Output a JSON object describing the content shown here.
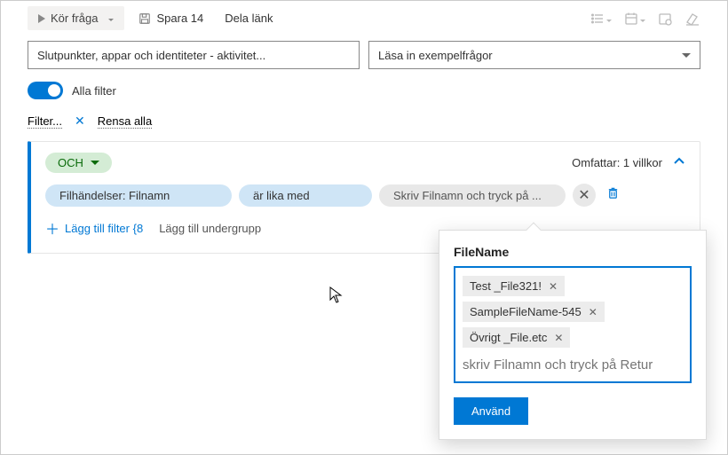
{
  "toolbar": {
    "run": "Kör fråga",
    "save": "Spara 14",
    "share": "Dela länk"
  },
  "inputs": {
    "endpoints": "Slutpunkter, appar och identiteter - aktivitet...",
    "examples": "Läsa in exempelfrågor"
  },
  "toggle": {
    "label": "Alla filter"
  },
  "filterLinks": {
    "filter": "Filter...",
    "clear": "Rensa alla"
  },
  "card": {
    "and": "OCH",
    "scope": "Omfattar: 1 villkor",
    "field": "Filhändelser: Filnamn",
    "op": "är lika med",
    "valuePlaceholder": "Skriv Filnamn och tryck på ...",
    "addFilter": "Lägg till filter {8",
    "addSubgroup": "Lägg till undergrupp"
  },
  "popup": {
    "title": "FileName",
    "tags": [
      "Test _File321!",
      "SampleFileName-545",
      "Övrigt _File.etc"
    ],
    "placeholder": "skriv Filnamn och tryck på Retur",
    "apply": "Använd"
  }
}
